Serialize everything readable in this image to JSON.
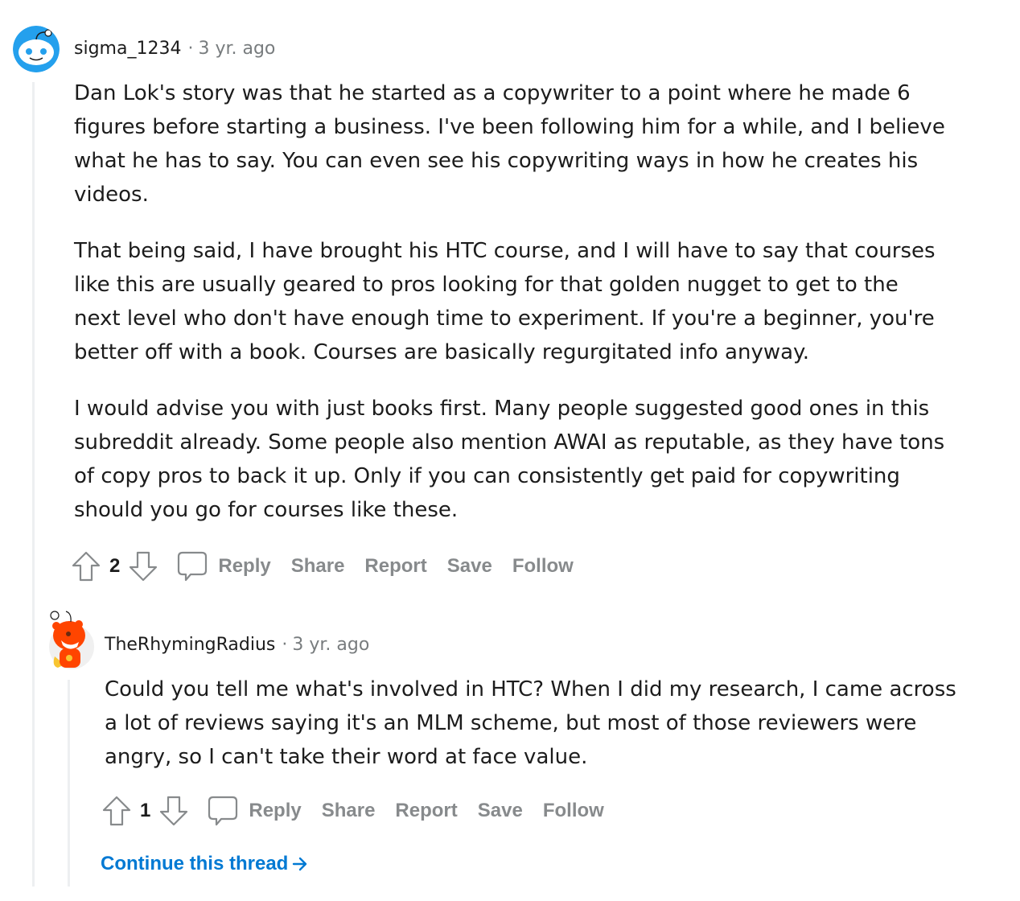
{
  "comments": [
    {
      "author": "sigma_1234",
      "separator": "·",
      "time": "3 yr. ago",
      "avatar": "snoo-blue-avatar",
      "paragraphs": [
        "Dan Lok's story was that he started as a copywriter to a point where he made 6 figures before starting a business. I've been following him for a while, and I believe what he has to say. You can even see his copywriting ways in how he creates his videos.",
        "That being said, I have brought his HTC course, and I will have to say that courses like this are usually geared to pros looking for that golden nugget to get to the next level who don't have enough time to experiment. If you're a beginner, you're better off with a book. Courses are basically regurgitated info anyway.",
        "I would advise you with just books first. Many people suggested good ones in this subreddit already. Some people also mention AWAI as reputable, as they have tons of copy pros to back it up. Only if you can consistently get paid for copywriting should you go for courses like these."
      ],
      "score": "2",
      "actions": [
        "Reply",
        "Share",
        "Report",
        "Save",
        "Follow"
      ]
    },
    {
      "author": "TheRhymingRadius",
      "separator": "·",
      "time": "3 yr. ago",
      "avatar": "snoo-orange-avatar",
      "paragraphs": [
        "Could you tell me what's involved in HTC? When I did my research, I came across a lot of reviews saying it's an MLM scheme, but most of those reviewers were angry, so I can't take their word at face value."
      ],
      "score": "1",
      "actions": [
        "Reply",
        "Share",
        "Report",
        "Save",
        "Follow"
      ]
    }
  ],
  "continue_thread": "Continue this thread",
  "colors": {
    "link": "#0079d3",
    "muted": "#878a8c",
    "thread_line": "#edeff1"
  }
}
